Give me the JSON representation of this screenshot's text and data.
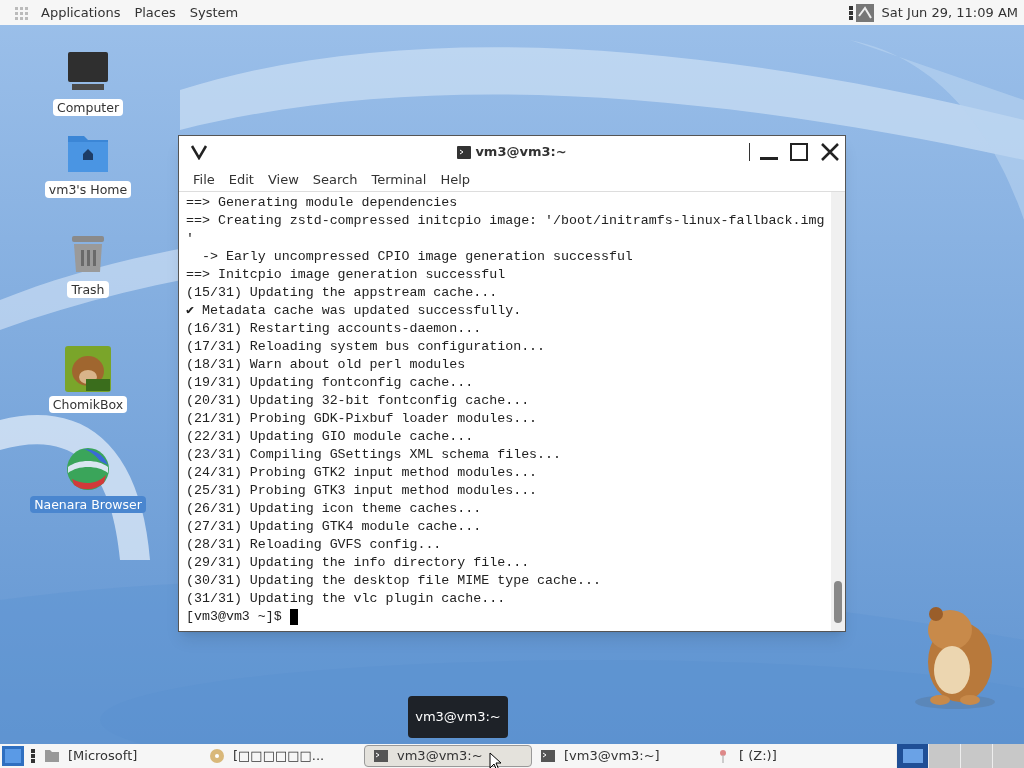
{
  "top_panel": {
    "menus": [
      "Applications",
      "Places",
      "System"
    ],
    "clock": "Sat Jun 29, 11:09 AM"
  },
  "desktop_icons": [
    {
      "kind": "computer",
      "label": "Computer",
      "selected": false
    },
    {
      "kind": "home",
      "label": "vm3's Home",
      "selected": false
    },
    {
      "kind": "trash",
      "label": "Trash",
      "selected": false
    },
    {
      "kind": "chomik",
      "label": "ChomikBox",
      "selected": false
    },
    {
      "kind": "browser",
      "label": "Naenara Browser",
      "selected": true
    }
  ],
  "terminal": {
    "title": "vm3@vm3:~",
    "menu": [
      "File",
      "Edit",
      "View",
      "Search",
      "Terminal",
      "Help"
    ],
    "lines": [
      "==> Generating module dependencies",
      "==> Creating zstd-compressed initcpio image: '/boot/initramfs-linux-fallback.img",
      "'",
      "  -> Early uncompressed CPIO image generation successful",
      "==> Initcpio image generation successful",
      "(15/31) Updating the appstream cache...",
      "✔ Metadata cache was updated successfully.",
      "(16/31) Restarting accounts-daemon...",
      "(17/31) Reloading system bus configuration...",
      "(18/31) Warn about old perl modules",
      "(19/31) Updating fontconfig cache...",
      "(20/31) Updating 32-bit fontconfig cache...",
      "(21/31) Probing GDK-Pixbuf loader modules...",
      "(22/31) Updating GIO module cache...",
      "(23/31) Compiling GSettings XML schema files...",
      "(24/31) Probing GTK2 input method modules...",
      "(25/31) Probing GTK3 input method modules...",
      "(26/31) Updating icon theme caches...",
      "(27/31) Updating GTK4 module cache...",
      "(28/31) Reloading GVFS config...",
      "(29/31) Updating the info directory file...",
      "(30/31) Updating the desktop file MIME type cache...",
      "(31/31) Updating the vlc plugin cache..."
    ],
    "prompt": "[vm3@vm3 ~]$"
  },
  "tooltip": "vm3@vm3:~",
  "taskbar": {
    "tasks": [
      {
        "kind": "folder",
        "label": "[Microsoft]",
        "selected": false
      },
      {
        "kind": "disc",
        "label": "[□□□□□□...",
        "selected": false
      },
      {
        "kind": "terminal",
        "label": "vm3@vm3:~",
        "selected": true
      },
      {
        "kind": "terminal",
        "label": "[vm3@vm3:~]",
        "selected": false
      },
      {
        "kind": "pin",
        "label": "[ (Z:)]",
        "selected": false
      }
    ],
    "workspaces": [
      {
        "selected": true
      },
      {
        "selected": false
      },
      {
        "selected": false
      },
      {
        "selected": false
      }
    ]
  }
}
